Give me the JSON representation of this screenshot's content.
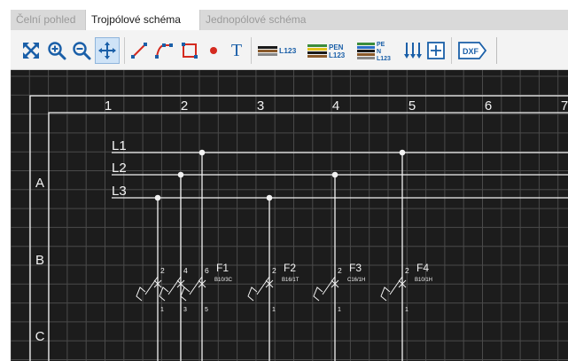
{
  "tabs": [
    {
      "label": "Čelní pohled",
      "active": false
    },
    {
      "label": "Trojpólové schéma",
      "active": true
    },
    {
      "label": "Jednopólové schéma",
      "active": false
    }
  ],
  "toolbar": {
    "buttons": [
      {
        "icon": "fit-to-screen-icon"
      },
      {
        "icon": "zoom-in-icon"
      },
      {
        "icon": "zoom-out-icon"
      },
      {
        "icon": "pan-move-icon",
        "selected": true
      },
      {
        "icon": "draw-line-icon"
      },
      {
        "icon": "draw-polyline-icon"
      },
      {
        "icon": "draw-rectangle-icon"
      },
      {
        "icon": "draw-point-icon"
      },
      {
        "icon": "insert-text-icon",
        "label": "T"
      },
      {
        "icon": "busbar-l123-icon",
        "label": "L123"
      },
      {
        "icon": "busbar-pen-l123-icon",
        "label_top": "PEN",
        "label_bottom": "L123"
      },
      {
        "icon": "busbar-pe-n-l123-icon",
        "label_top": "PE",
        "label_mid": "N",
        "label_bottom": "L123"
      },
      {
        "icon": "vertical-connections-icon"
      },
      {
        "icon": "insert-box-icon"
      },
      {
        "icon": "export-dxf-icon",
        "label": "DXF"
      }
    ]
  },
  "drawing": {
    "columns": [
      "1",
      "2",
      "3",
      "4",
      "5",
      "6",
      "7"
    ],
    "rows": [
      "A",
      "B",
      "C"
    ],
    "buses": [
      "L1",
      "L2",
      "L3"
    ],
    "breakers": [
      {
        "name": "F1",
        "desc": "B10/3C",
        "top_terms": [
          "2",
          "4",
          "6"
        ],
        "bottom_terms": [
          "1",
          "3",
          "5"
        ]
      },
      {
        "name": "F2",
        "desc": "B16/1T",
        "top_terms": [
          "2"
        ],
        "bottom_terms": [
          "1"
        ]
      },
      {
        "name": "F3",
        "desc": "C16/1H",
        "top_terms": [
          "2"
        ],
        "bottom_terms": [
          "1"
        ]
      },
      {
        "name": "F4",
        "desc": "B10/1H",
        "top_terms": [
          "2"
        ],
        "bottom_terms": [
          "1"
        ]
      }
    ]
  },
  "colors": {
    "canvas_bg": "#1c1c1c",
    "grid": "#4a4a4a",
    "drawing": "#f2f2f2",
    "toolbar_blue": "#1a5fa8",
    "toolbar_red": "#d42a1f"
  }
}
